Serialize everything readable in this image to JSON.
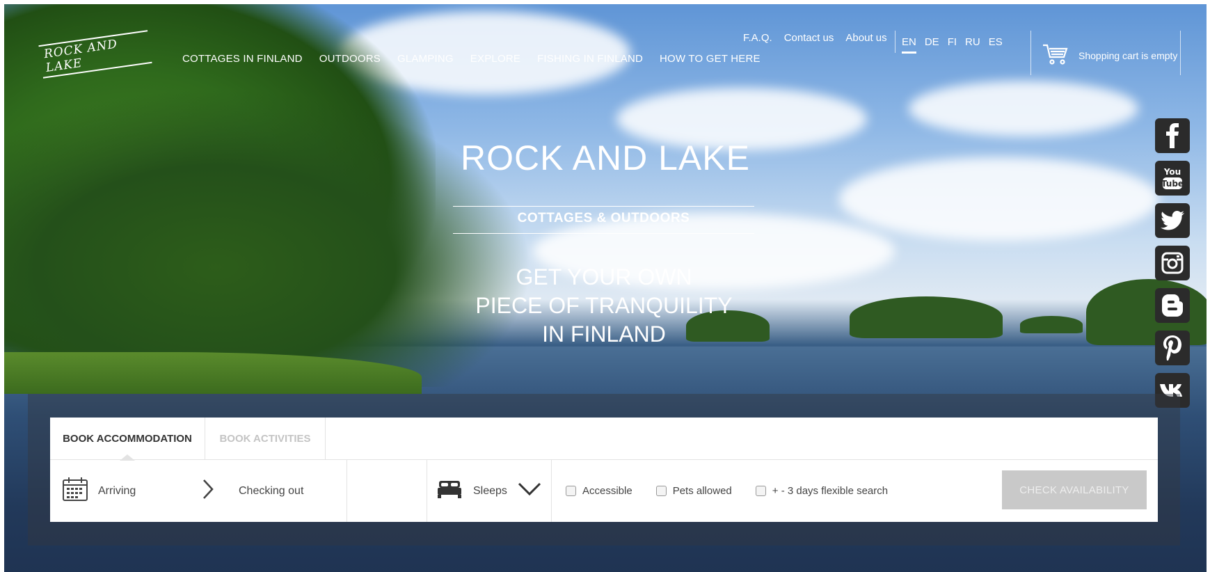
{
  "brand": {
    "logo_text": "ROCK AND LAKE"
  },
  "nav": {
    "main": [
      "COTTAGES IN FINLAND",
      "OUTDOORS",
      "GLAMPING",
      "EXPLORE",
      "FISHING IN FINLAND",
      "HOW TO GET HERE"
    ],
    "top_links": [
      "F.A.Q.",
      "Contact us",
      "About us"
    ],
    "languages": [
      "EN",
      "DE",
      "FI",
      "RU",
      "ES"
    ],
    "active_language": "EN"
  },
  "cart": {
    "label": "Shopping cart is empty",
    "icon": "cart-icon"
  },
  "hero": {
    "title": "ROCK AND LAKE",
    "subtitle": "COTTAGES & OUTDOORS",
    "tagline_lines": [
      "GET YOUR OWN",
      "PIECE OF TRANQUILITY",
      "IN FINLAND"
    ]
  },
  "social": [
    "facebook-icon",
    "youtube-icon",
    "twitter-icon",
    "instagram-icon",
    "blogger-icon",
    "pinterest-icon",
    "vk-icon"
  ],
  "booking": {
    "tabs": [
      {
        "label": "BOOK ACCOMMODATION",
        "active": true
      },
      {
        "label": "BOOK ACTIVITIES",
        "active": false
      }
    ],
    "arriving_label": "Arriving",
    "checking_out_label": "Checking out",
    "sleeps_label": "Sleeps",
    "checkboxes": [
      {
        "label": "Accessible",
        "checked": false
      },
      {
        "label": "Pets allowed",
        "checked": false
      },
      {
        "label": "+ - 3 days flexible search",
        "checked": false
      }
    ],
    "submit_label": "CHECK AVAILABILITY"
  },
  "colors": {
    "panel_bg": "#ffffff",
    "button_disabled": "#c9c9c9",
    "social_bg": "#2b2b2b",
    "text_dark": "#333333"
  }
}
